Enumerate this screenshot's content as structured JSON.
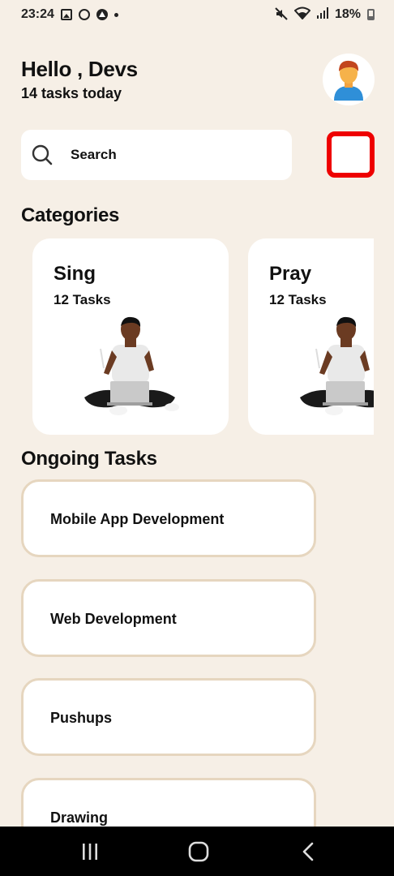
{
  "status_bar": {
    "time": "23:24",
    "battery": "18%",
    "left_icons": [
      "gallery-icon",
      "whatsapp-icon",
      "app-icon",
      "notification-dot-icon"
    ],
    "right_icons": [
      "mute-icon",
      "wifi-icon",
      "signal-icon",
      "battery-icon"
    ]
  },
  "header": {
    "greeting": "Hello , Devs",
    "subtitle": "14 tasks today",
    "avatar_icon": "user-avatar-icon"
  },
  "search": {
    "placeholder": "Search",
    "filter_border_color": "#ee0000"
  },
  "categories": {
    "title": "Categories",
    "items": [
      {
        "name": "Sing",
        "count": "12 Tasks"
      },
      {
        "name": "Pray",
        "count": "12 Tasks"
      }
    ]
  },
  "ongoing": {
    "title": "Ongoing Tasks",
    "items": [
      {
        "label": "Mobile App Development"
      },
      {
        "label": "Web Development"
      },
      {
        "label": "Pushups"
      },
      {
        "label": "Drawing"
      }
    ]
  },
  "nav": {
    "icons": [
      "recent-apps-icon",
      "home-icon",
      "back-icon"
    ]
  },
  "colors": {
    "background": "#f6efe6",
    "card": "#ffffff",
    "task_border": "#e6d6bf",
    "accent_red": "#ee0000"
  }
}
